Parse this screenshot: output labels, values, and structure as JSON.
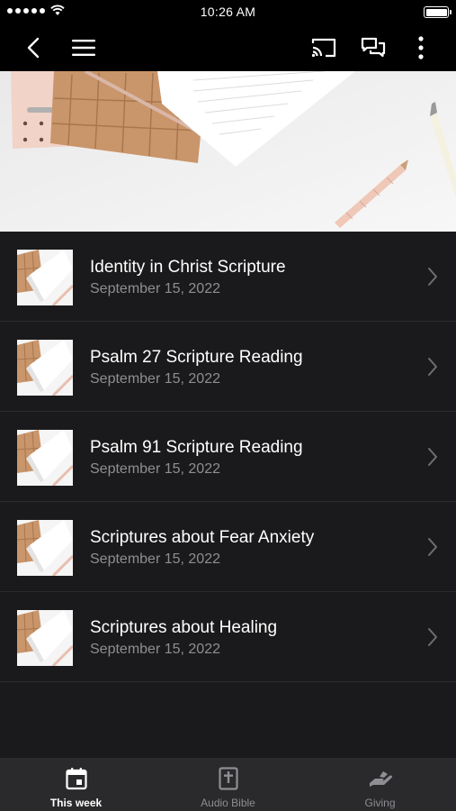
{
  "status_bar": {
    "time": "10:26 AM"
  },
  "items": [
    {
      "title": "Identity in Christ Scripture",
      "date": "September 15, 2022"
    },
    {
      "title": "Psalm 27 Scripture Reading",
      "date": "September 15, 2022"
    },
    {
      "title": "Psalm 91 Scripture Reading",
      "date": "September 15, 2022"
    },
    {
      "title": "Scriptures about Fear Anxiety",
      "date": "September 15, 2022"
    },
    {
      "title": "Scriptures about Healing",
      "date": "September 15, 2022"
    }
  ],
  "tabs": [
    {
      "label": "This week",
      "icon": "calendar-icon",
      "active": true
    },
    {
      "label": "Audio Bible",
      "icon": "bible-icon",
      "active": false
    },
    {
      "label": "Giving",
      "icon": "giving-hand-icon",
      "active": false
    }
  ],
  "colors": {
    "background": "#1a1a1c",
    "tabbar": "#2a2a2c",
    "secondary_text": "#8e8e93"
  }
}
